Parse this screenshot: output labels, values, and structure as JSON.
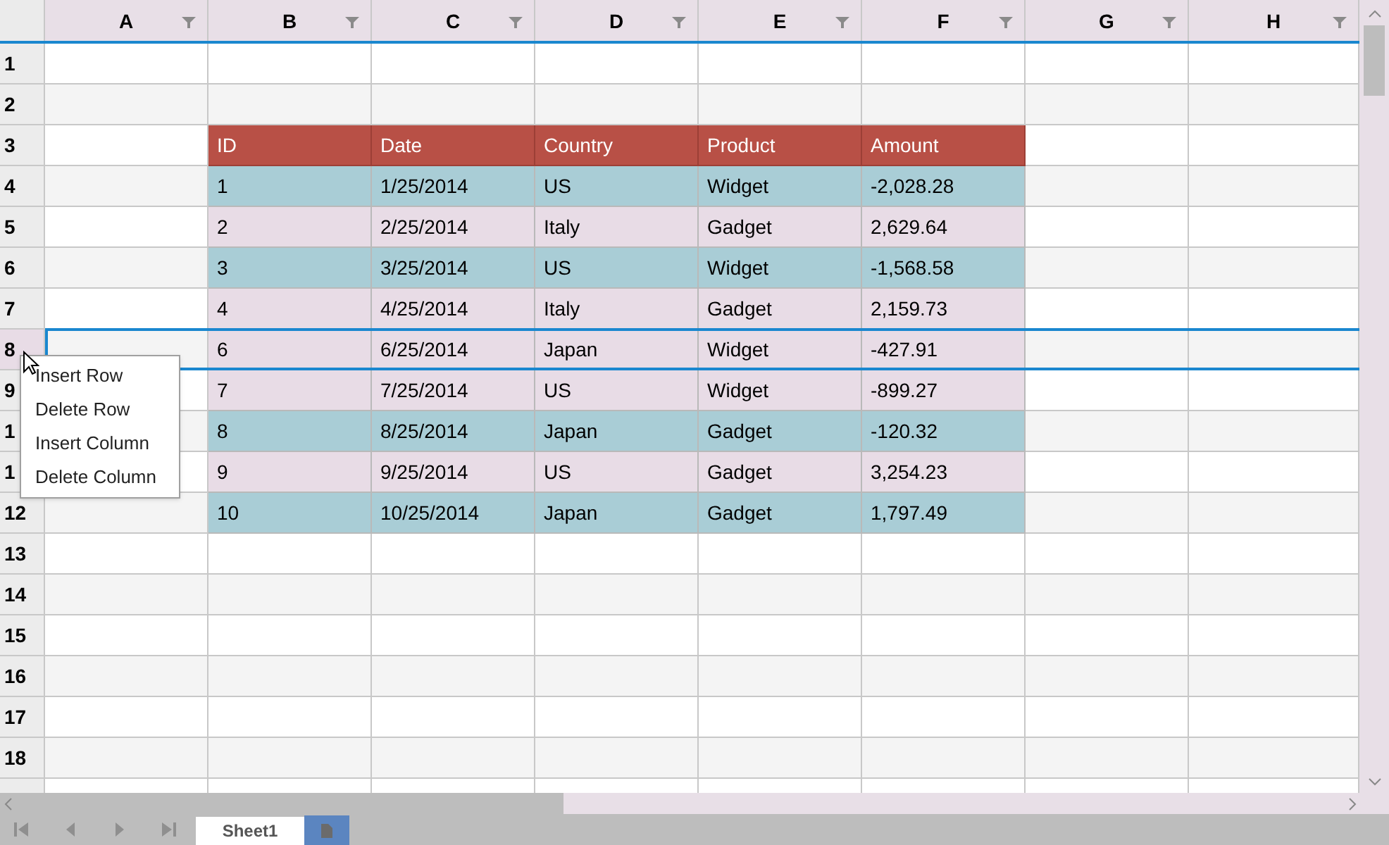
{
  "columns": [
    {
      "label": "A"
    },
    {
      "label": "B"
    },
    {
      "label": "C"
    },
    {
      "label": "D"
    },
    {
      "label": "E"
    },
    {
      "label": "F"
    },
    {
      "label": "G"
    },
    {
      "label": "H"
    }
  ],
  "row_headers": [
    {
      "label": "1",
      "selected": false
    },
    {
      "label": "2",
      "selected": false
    },
    {
      "label": "3",
      "selected": false
    },
    {
      "label": "4",
      "selected": false
    },
    {
      "label": "5",
      "selected": false
    },
    {
      "label": "6",
      "selected": false
    },
    {
      "label": "7",
      "selected": false
    },
    {
      "label": "8",
      "selected": true
    },
    {
      "label": "9",
      "selected": false
    },
    {
      "label": "1",
      "selected": false
    },
    {
      "label": "1",
      "selected": false
    },
    {
      "label": "12",
      "selected": false
    },
    {
      "label": "13",
      "selected": false
    },
    {
      "label": "14",
      "selected": false
    },
    {
      "label": "15",
      "selected": false
    },
    {
      "label": "16",
      "selected": false
    },
    {
      "label": "17",
      "selected": false
    },
    {
      "label": "18",
      "selected": false
    }
  ],
  "data_table": {
    "header": {
      "color": "#b85046",
      "cells": [
        "ID",
        "Date",
        "Country",
        "Product",
        "Amount"
      ]
    },
    "rows": [
      {
        "color": "#a9cdd6",
        "cells": [
          "1",
          "1/25/2014",
          "US",
          "Widget",
          "-2,028.28"
        ]
      },
      {
        "color": "#e8dce6",
        "cells": [
          "2",
          "2/25/2014",
          "Italy",
          "Gadget",
          "2,629.64"
        ]
      },
      {
        "color": "#a9cdd6",
        "cells": [
          "3",
          "3/25/2014",
          "US",
          "Widget",
          "-1,568.58"
        ]
      },
      {
        "color": "#e8dce6",
        "cells": [
          "4",
          "4/25/2014",
          "Italy",
          "Gadget",
          "2,159.73"
        ]
      },
      {
        "color": "#e8dce6",
        "cells": [
          "6",
          "6/25/2014",
          "Japan",
          "Widget",
          "-427.91"
        ]
      },
      {
        "color": "#e8dce6",
        "cells": [
          "7",
          "7/25/2014",
          "US",
          "Widget",
          "-899.27"
        ]
      },
      {
        "color": "#a9cdd6",
        "cells": [
          "8",
          "8/25/2014",
          "Japan",
          "Gadget",
          "-120.32"
        ]
      },
      {
        "color": "#e8dce6",
        "cells": [
          "9",
          "9/25/2014",
          "US",
          "Gadget",
          "3,254.23"
        ]
      },
      {
        "color": "#a9cdd6",
        "cells": [
          "10",
          "10/25/2014",
          "Japan",
          "Gadget",
          "1,797.49"
        ]
      }
    ]
  },
  "context_menu": {
    "items": [
      {
        "label": "Insert Row"
      },
      {
        "label": "Delete Row"
      },
      {
        "label": "Insert Column"
      },
      {
        "label": "Delete Column"
      }
    ]
  },
  "sheet_tabs": [
    {
      "label": "Sheet1",
      "selected": true
    }
  ]
}
